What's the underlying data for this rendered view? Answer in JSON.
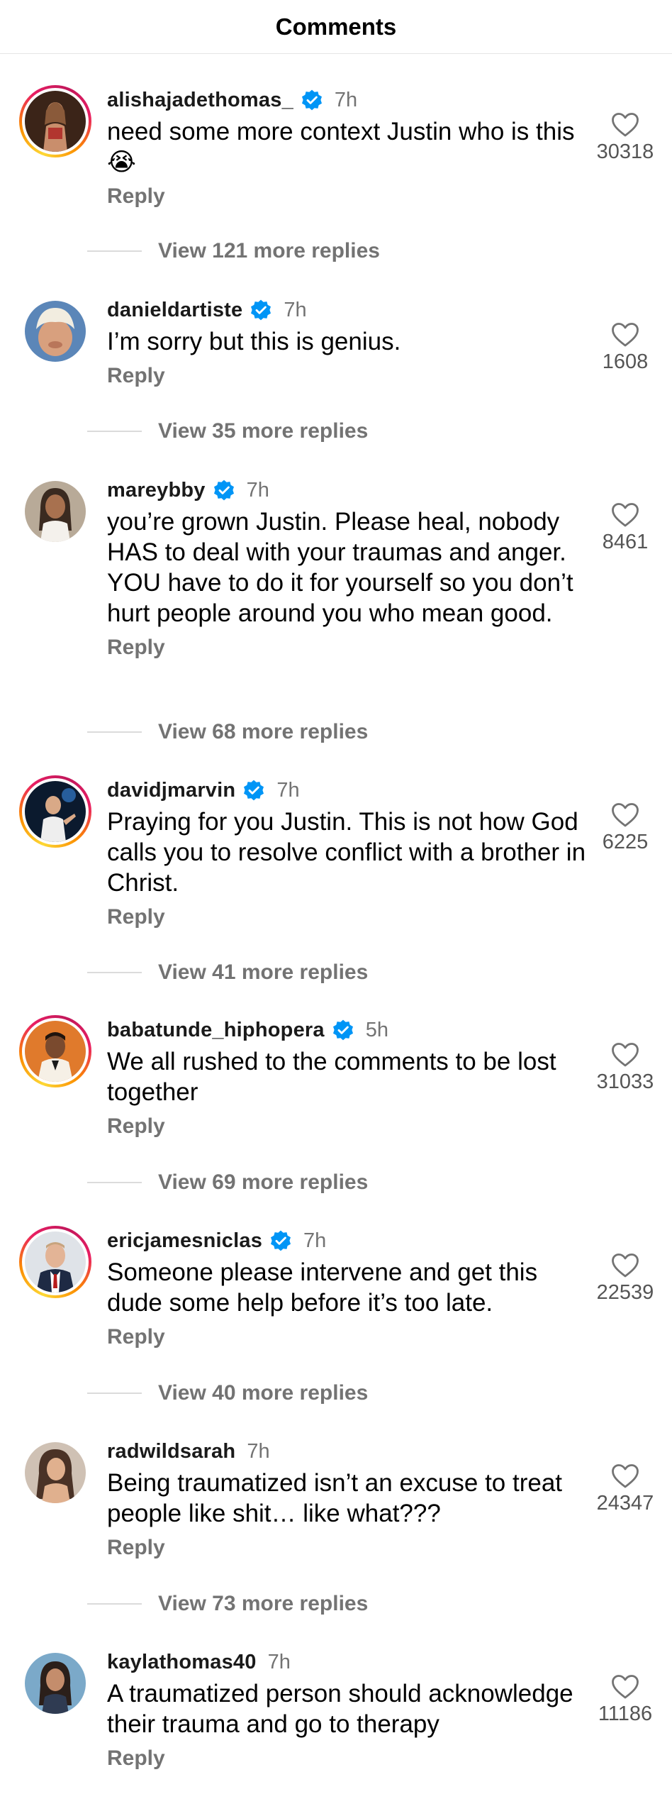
{
  "header": {
    "title": "Comments"
  },
  "ui": {
    "reply_label": "Reply"
  },
  "colors": {
    "verified": "#0095f6",
    "muted": "#737373",
    "story_ring": "#e91e63"
  },
  "comments": [
    {
      "username": "alishajadethomas_",
      "verified": true,
      "time": "7h",
      "text": "need some more context Justin who is this 😭",
      "likes": "30318",
      "view_replies": "View 121 more replies",
      "story_ring": true,
      "avatar_icon": "woman-avatar"
    },
    {
      "username": "danieldartiste",
      "verified": true,
      "time": "7h",
      "text": "I’m sorry but this is genius.",
      "likes": "1608",
      "view_replies": "View 35 more replies",
      "story_ring": false,
      "avatar_icon": "blonde-man-avatar"
    },
    {
      "username": "mareybby",
      "verified": true,
      "time": "7h",
      "text": "you’re grown Justin. Please heal, nobody HAS to deal with your traumas and anger. YOU have to do it for yourself so you don’t hurt people around you who mean good.",
      "likes": "8461",
      "view_replies": "View 68 more replies",
      "story_ring": false,
      "avatar_icon": "woman-avatar"
    },
    {
      "username": "davidjmarvin",
      "verified": true,
      "time": "7h",
      "text": "Praying for you Justin. This is not how God calls you to resolve conflict with a brother in Christ.",
      "likes": "6225",
      "view_replies": "View 41 more replies",
      "story_ring": true,
      "avatar_icon": "stage-man-avatar"
    },
    {
      "username": "babatunde_hiphopera",
      "verified": true,
      "time": "5h",
      "text": "We all rushed to the comments to be lost together",
      "likes": "31033",
      "view_replies": "View 69 more replies",
      "story_ring": true,
      "avatar_icon": "man-avatar"
    },
    {
      "username": "ericjamesniclas",
      "verified": true,
      "time": "7h",
      "text": "Someone please intervene and get this dude some help before it’s too late.",
      "likes": "22539",
      "view_replies": "View 40 more replies",
      "story_ring": true,
      "avatar_icon": "suit-man-avatar"
    },
    {
      "username": "radwildsarah",
      "verified": false,
      "time": "7h",
      "text": "Being traumatized isn’t an excuse to treat people like shit… like what???",
      "likes": "24347",
      "view_replies": "View 73 more replies",
      "story_ring": false,
      "avatar_icon": "woman-avatar"
    },
    {
      "username": "kaylathomas40",
      "verified": false,
      "time": "7h",
      "text": "A traumatized person should acknowledge their trauma and go to therapy",
      "likes": "11186",
      "view_replies": "",
      "story_ring": false,
      "avatar_icon": "woman-avatar"
    }
  ]
}
